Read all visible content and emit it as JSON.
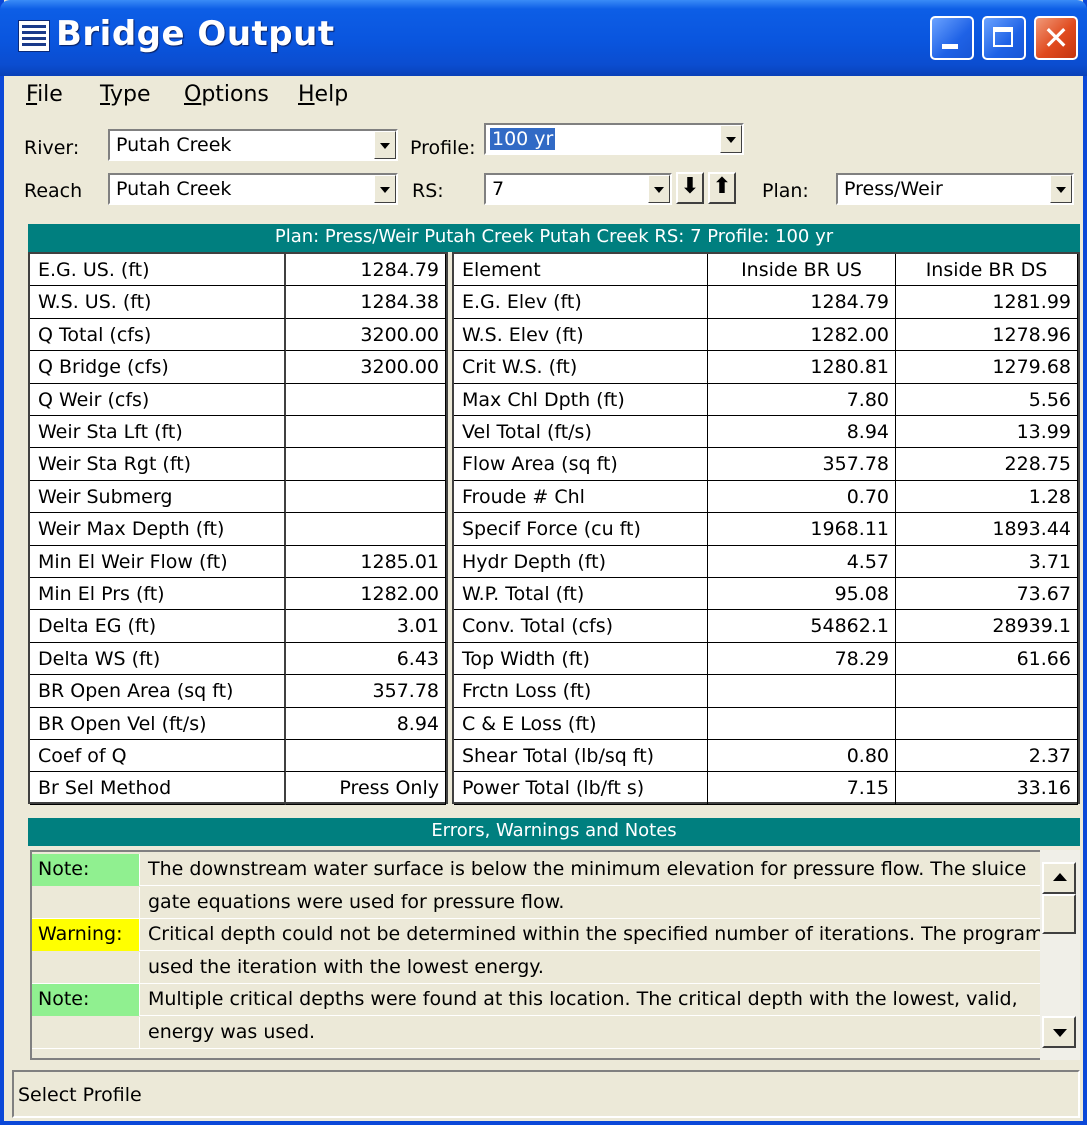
{
  "window": {
    "title": "Bridge Output"
  },
  "menu": [
    {
      "label": "File",
      "u": "F",
      "rest": "ile"
    },
    {
      "label": "Type",
      "u": "T",
      "rest": "ype"
    },
    {
      "label": "Options",
      "u": "O",
      "rest": "ptions"
    },
    {
      "label": "Help",
      "u": "H",
      "rest": "elp"
    }
  ],
  "selectors": {
    "river_label": "River:",
    "river_value": "Putah Creek",
    "profile_label": "Profile:",
    "profile_value": "100 yr",
    "reach_label": "Reach",
    "reach_value": "Putah Creek",
    "rs_label": "RS:",
    "rs_value": "7",
    "plan_label": "Plan:",
    "plan_value": "Press/Weir",
    "down_arrow": "⬇",
    "up_arrow": "⬆"
  },
  "table_header": "Plan: Press/Weir    Putah Creek    Putah Creek  RS: 7       Profile: 100 yr",
  "left_table": [
    {
      "label": "E.G. US. (ft)",
      "value": "1284.79"
    },
    {
      "label": "W.S. US. (ft)",
      "value": "1284.38"
    },
    {
      "label": "Q Total (cfs)",
      "value": "3200.00"
    },
    {
      "label": "Q Bridge (cfs)",
      "value": "3200.00"
    },
    {
      "label": "Q Weir (cfs)",
      "value": ""
    },
    {
      "label": "Weir Sta Lft (ft)",
      "value": ""
    },
    {
      "label": "Weir Sta Rgt (ft)",
      "value": ""
    },
    {
      "label": "Weir Submerg",
      "value": ""
    },
    {
      "label": "Weir Max Depth (ft)",
      "value": ""
    },
    {
      "label": "Min El Weir Flow (ft)",
      "value": "1285.01"
    },
    {
      "label": "Min El Prs (ft)",
      "value": "1282.00"
    },
    {
      "label": "Delta EG (ft)",
      "value": "3.01"
    },
    {
      "label": "Delta WS (ft)",
      "value": "6.43"
    },
    {
      "label": "BR Open Area (sq ft)",
      "value": "357.78"
    },
    {
      "label": "BR Open Vel (ft/s)",
      "value": "8.94"
    },
    {
      "label": "Coef of Q",
      "value": ""
    },
    {
      "label": "Br Sel Method",
      "value": "Press Only"
    }
  ],
  "right_table": {
    "headers": [
      "Element",
      "Inside BR US",
      "Inside BR DS"
    ],
    "rows": [
      {
        "label": "E.G. Elev (ft)",
        "us": "1284.79",
        "ds": "1281.99"
      },
      {
        "label": "W.S. Elev (ft)",
        "us": "1282.00",
        "ds": "1278.96"
      },
      {
        "label": "Crit W.S. (ft)",
        "us": "1280.81",
        "ds": "1279.68"
      },
      {
        "label": "Max Chl Dpth (ft)",
        "us": "7.80",
        "ds": "5.56"
      },
      {
        "label": "Vel Total (ft/s)",
        "us": "8.94",
        "ds": "13.99"
      },
      {
        "label": "Flow Area (sq ft)",
        "us": "357.78",
        "ds": "228.75"
      },
      {
        "label": "Froude # Chl",
        "us": "0.70",
        "ds": "1.28"
      },
      {
        "label": "Specif Force (cu ft)",
        "us": "1968.11",
        "ds": "1893.44"
      },
      {
        "label": "Hydr Depth (ft)",
        "us": "4.57",
        "ds": "3.71"
      },
      {
        "label": "W.P. Total (ft)",
        "us": "95.08",
        "ds": "73.67"
      },
      {
        "label": "Conv. Total (cfs)",
        "us": "54862.1",
        "ds": "28939.1"
      },
      {
        "label": "Top Width (ft)",
        "us": "78.29",
        "ds": "61.66"
      },
      {
        "label": "Frctn Loss (ft)",
        "us": "",
        "ds": ""
      },
      {
        "label": "C & E Loss (ft)",
        "us": "",
        "ds": ""
      },
      {
        "label": "Shear Total (lb/sq ft)",
        "us": "0.80",
        "ds": "2.37"
      },
      {
        "label": "Power Total (lb/ft s)",
        "us": "7.15",
        "ds": "33.16"
      }
    ]
  },
  "notes_header": "Errors, Warnings and Notes",
  "notes": [
    {
      "tag": "Note:",
      "kind": "note",
      "text": "The downstream water surface is below the minimum elevation for pressure flow.  The sluice"
    },
    {
      "tag": "",
      "kind": "",
      "text": "gate equations were used for pressure flow."
    },
    {
      "tag": "Warning:",
      "kind": "warn",
      "text": "Critical depth could not be determined within the specified number of iterations.  The program"
    },
    {
      "tag": "",
      "kind": "",
      "text": "used the iteration with the lowest energy."
    },
    {
      "tag": "Note:",
      "kind": "note",
      "text": "Multiple critical depths were found at this location.  The critical depth with the lowest, valid,"
    },
    {
      "tag": "",
      "kind": "",
      "text": "energy was used."
    }
  ],
  "status": "Select Profile",
  "colors": {
    "titlebar": "#0a55de",
    "teal_header": "#007f7f",
    "note_tag": "#90f090",
    "warning_tag": "#ffff00",
    "selection": "#316ac5"
  }
}
